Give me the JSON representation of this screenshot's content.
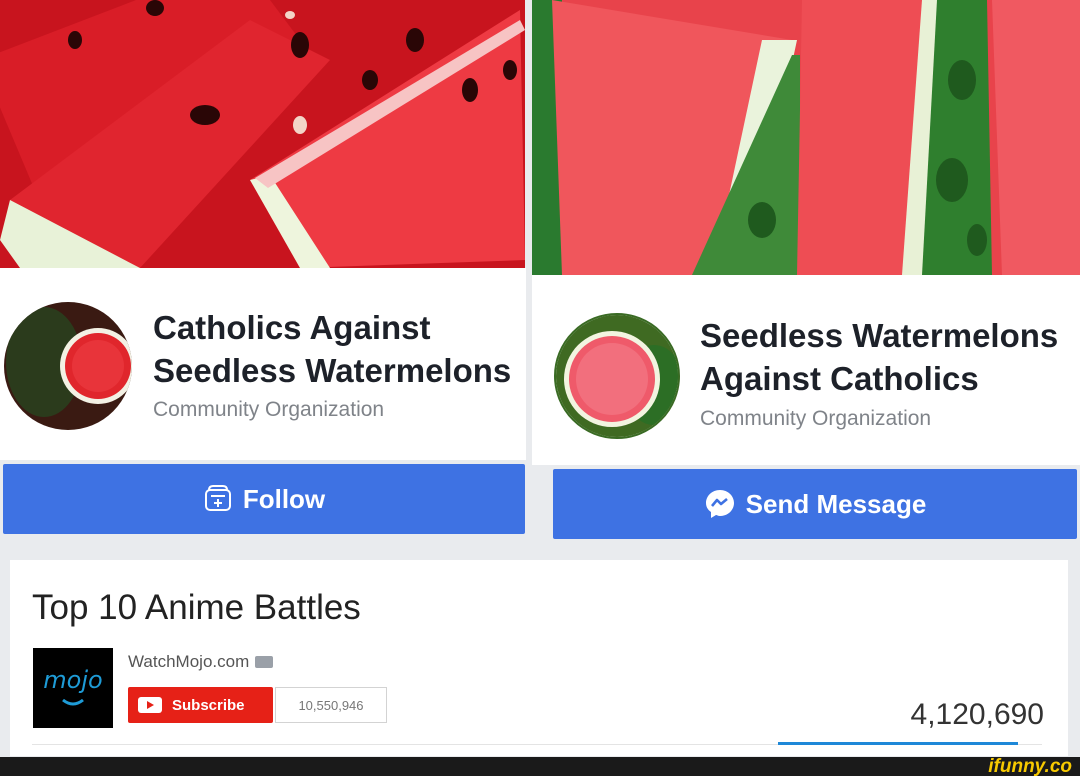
{
  "left_page": {
    "name": "Catholics Against Seedless Watermelons",
    "category": "Community Organization",
    "action_label": "Follow",
    "action_icon": "follow-plus-icon"
  },
  "right_page": {
    "name": "Seedless Watermelons Against Catholics",
    "category": "Community Organization",
    "action_label": "Send Message",
    "action_icon": "messenger-icon"
  },
  "video": {
    "title": "Top 10 Anime Battles",
    "channel_name": "WatchMojo.com",
    "channel_logo_text": "mojo",
    "subscribe_label": "Subscribe",
    "subscriber_count": "10,550,946",
    "view_count": "4,120,690",
    "like_ratio": 0.98
  },
  "watermark": "ifunny.co",
  "colors": {
    "facebook_blue": "#3e72e3",
    "youtube_red": "#e62117",
    "watermark_yellow": "#f7c900"
  }
}
